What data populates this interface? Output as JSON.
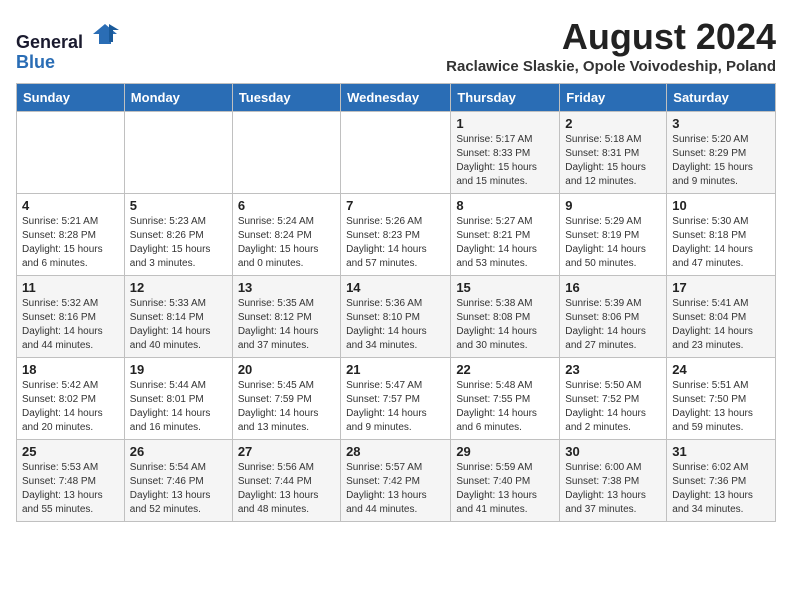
{
  "header": {
    "logo_general": "General",
    "logo_blue": "Blue",
    "month_title": "August 2024",
    "location": "Raclawice Slaskie, Opole Voivodeship, Poland"
  },
  "days_of_week": [
    "Sunday",
    "Monday",
    "Tuesday",
    "Wednesday",
    "Thursday",
    "Friday",
    "Saturday"
  ],
  "weeks": [
    [
      {
        "day": "",
        "content": ""
      },
      {
        "day": "",
        "content": ""
      },
      {
        "day": "",
        "content": ""
      },
      {
        "day": "",
        "content": ""
      },
      {
        "day": "1",
        "content": "Sunrise: 5:17 AM\nSunset: 8:33 PM\nDaylight: 15 hours\nand 15 minutes."
      },
      {
        "day": "2",
        "content": "Sunrise: 5:18 AM\nSunset: 8:31 PM\nDaylight: 15 hours\nand 12 minutes."
      },
      {
        "day": "3",
        "content": "Sunrise: 5:20 AM\nSunset: 8:29 PM\nDaylight: 15 hours\nand 9 minutes."
      }
    ],
    [
      {
        "day": "4",
        "content": "Sunrise: 5:21 AM\nSunset: 8:28 PM\nDaylight: 15 hours\nand 6 minutes."
      },
      {
        "day": "5",
        "content": "Sunrise: 5:23 AM\nSunset: 8:26 PM\nDaylight: 15 hours\nand 3 minutes."
      },
      {
        "day": "6",
        "content": "Sunrise: 5:24 AM\nSunset: 8:24 PM\nDaylight: 15 hours\nand 0 minutes."
      },
      {
        "day": "7",
        "content": "Sunrise: 5:26 AM\nSunset: 8:23 PM\nDaylight: 14 hours\nand 57 minutes."
      },
      {
        "day": "8",
        "content": "Sunrise: 5:27 AM\nSunset: 8:21 PM\nDaylight: 14 hours\nand 53 minutes."
      },
      {
        "day": "9",
        "content": "Sunrise: 5:29 AM\nSunset: 8:19 PM\nDaylight: 14 hours\nand 50 minutes."
      },
      {
        "day": "10",
        "content": "Sunrise: 5:30 AM\nSunset: 8:18 PM\nDaylight: 14 hours\nand 47 minutes."
      }
    ],
    [
      {
        "day": "11",
        "content": "Sunrise: 5:32 AM\nSunset: 8:16 PM\nDaylight: 14 hours\nand 44 minutes."
      },
      {
        "day": "12",
        "content": "Sunrise: 5:33 AM\nSunset: 8:14 PM\nDaylight: 14 hours\nand 40 minutes."
      },
      {
        "day": "13",
        "content": "Sunrise: 5:35 AM\nSunset: 8:12 PM\nDaylight: 14 hours\nand 37 minutes."
      },
      {
        "day": "14",
        "content": "Sunrise: 5:36 AM\nSunset: 8:10 PM\nDaylight: 14 hours\nand 34 minutes."
      },
      {
        "day": "15",
        "content": "Sunrise: 5:38 AM\nSunset: 8:08 PM\nDaylight: 14 hours\nand 30 minutes."
      },
      {
        "day": "16",
        "content": "Sunrise: 5:39 AM\nSunset: 8:06 PM\nDaylight: 14 hours\nand 27 minutes."
      },
      {
        "day": "17",
        "content": "Sunrise: 5:41 AM\nSunset: 8:04 PM\nDaylight: 14 hours\nand 23 minutes."
      }
    ],
    [
      {
        "day": "18",
        "content": "Sunrise: 5:42 AM\nSunset: 8:02 PM\nDaylight: 14 hours\nand 20 minutes."
      },
      {
        "day": "19",
        "content": "Sunrise: 5:44 AM\nSunset: 8:01 PM\nDaylight: 14 hours\nand 16 minutes."
      },
      {
        "day": "20",
        "content": "Sunrise: 5:45 AM\nSunset: 7:59 PM\nDaylight: 14 hours\nand 13 minutes."
      },
      {
        "day": "21",
        "content": "Sunrise: 5:47 AM\nSunset: 7:57 PM\nDaylight: 14 hours\nand 9 minutes."
      },
      {
        "day": "22",
        "content": "Sunrise: 5:48 AM\nSunset: 7:55 PM\nDaylight: 14 hours\nand 6 minutes."
      },
      {
        "day": "23",
        "content": "Sunrise: 5:50 AM\nSunset: 7:52 PM\nDaylight: 14 hours\nand 2 minutes."
      },
      {
        "day": "24",
        "content": "Sunrise: 5:51 AM\nSunset: 7:50 PM\nDaylight: 13 hours\nand 59 minutes."
      }
    ],
    [
      {
        "day": "25",
        "content": "Sunrise: 5:53 AM\nSunset: 7:48 PM\nDaylight: 13 hours\nand 55 minutes."
      },
      {
        "day": "26",
        "content": "Sunrise: 5:54 AM\nSunset: 7:46 PM\nDaylight: 13 hours\nand 52 minutes."
      },
      {
        "day": "27",
        "content": "Sunrise: 5:56 AM\nSunset: 7:44 PM\nDaylight: 13 hours\nand 48 minutes."
      },
      {
        "day": "28",
        "content": "Sunrise: 5:57 AM\nSunset: 7:42 PM\nDaylight: 13 hours\nand 44 minutes."
      },
      {
        "day": "29",
        "content": "Sunrise: 5:59 AM\nSunset: 7:40 PM\nDaylight: 13 hours\nand 41 minutes."
      },
      {
        "day": "30",
        "content": "Sunrise: 6:00 AM\nSunset: 7:38 PM\nDaylight: 13 hours\nand 37 minutes."
      },
      {
        "day": "31",
        "content": "Sunrise: 6:02 AM\nSunset: 7:36 PM\nDaylight: 13 hours\nand 34 minutes."
      }
    ]
  ]
}
